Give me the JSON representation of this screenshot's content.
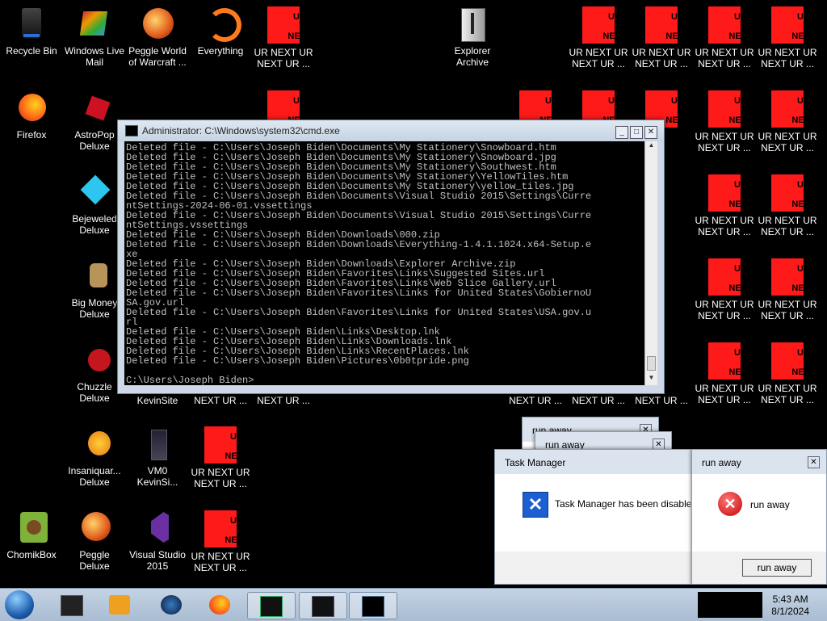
{
  "desktop": {
    "icons": [
      {
        "label": "Recycle Bin"
      },
      {
        "label": "Windows Live\nMail"
      },
      {
        "label": "Peggle World\nof Warcraft ..."
      },
      {
        "label": "Everything"
      },
      {
        "label": "UR NEXT UR\nNEXT UR ..."
      },
      {
        "label": "Explorer\nArchive"
      },
      {
        "label": "Firefox"
      },
      {
        "label": "AstroPop\nDeluxe"
      },
      {
        "label": "Bejeweled\nDeluxe"
      },
      {
        "label": "Big Money\nDeluxe"
      },
      {
        "label": "Chuzzle\nDeluxe"
      },
      {
        "label": "KevinSite"
      },
      {
        "label": "Insaniquar...\nDeluxe"
      },
      {
        "label": "VM0\nKevinSi..."
      },
      {
        "label": "ChomikBox"
      },
      {
        "label": "Peggle Deluxe"
      },
      {
        "label": "Visual Studio\n2015"
      }
    ],
    "ur_icon": {
      "top": "UR",
      "bottom": "NEXT",
      "label": "UR NEXT UR\nNEXT UR ...",
      "partial_label": "NEXT UR ..."
    }
  },
  "cmd": {
    "title": "Administrator: C:\\Windows\\system32\\cmd.exe",
    "lines": [
      "Deleted file - C:\\Users\\Joseph Biden\\Documents\\My Stationery\\Snowboard.htm",
      "Deleted file - C:\\Users\\Joseph Biden\\Documents\\My Stationery\\Snowboard.jpg",
      "Deleted file - C:\\Users\\Joseph Biden\\Documents\\My Stationery\\Southwest.htm",
      "Deleted file - C:\\Users\\Joseph Biden\\Documents\\My Stationery\\YellowTiles.htm",
      "Deleted file - C:\\Users\\Joseph Biden\\Documents\\My Stationery\\yellow_tiles.jpg",
      "Deleted file - C:\\Users\\Joseph Biden\\Documents\\Visual Studio 2015\\Settings\\Curre",
      "ntSettings-2024-06-01.vssettings",
      "Deleted file - C:\\Users\\Joseph Biden\\Documents\\Visual Studio 2015\\Settings\\Curre",
      "ntSettings.vssettings",
      "Deleted file - C:\\Users\\Joseph Biden\\Downloads\\000.zip",
      "Deleted file - C:\\Users\\Joseph Biden\\Downloads\\Everything-1.4.1.1024.x64-Setup.e",
      "xe",
      "Deleted file - C:\\Users\\Joseph Biden\\Downloads\\Explorer Archive.zip",
      "Deleted file - C:\\Users\\Joseph Biden\\Favorites\\Links\\Suggested Sites.url",
      "Deleted file - C:\\Users\\Joseph Biden\\Favorites\\Links\\Web Slice Gallery.url",
      "Deleted file - C:\\Users\\Joseph Biden\\Favorites\\Links for United States\\GobiernoU",
      "SA.gov.url",
      "Deleted file - C:\\Users\\Joseph Biden\\Favorites\\Links for United States\\USA.gov.u",
      "rl",
      "Deleted file - C:\\Users\\Joseph Biden\\Links\\Desktop.lnk",
      "Deleted file - C:\\Users\\Joseph Biden\\Links\\Downloads.lnk",
      "Deleted file - C:\\Users\\Joseph Biden\\Links\\RecentPlaces.lnk",
      "Deleted file - C:\\Users\\Joseph Biden\\Pictures\\0b0tpride.png",
      "",
      "C:\\Users\\Joseph Biden>"
    ]
  },
  "task_manager_dialog": {
    "title": "Task Manager",
    "message": "Task Manager has been disabled"
  },
  "run_away_dialog": {
    "title": "run away",
    "message": "run away",
    "button": "run away"
  },
  "run_away_back": {
    "title": "run away"
  },
  "taskbar": {
    "clock_time": "5:43 AM",
    "clock_date": "8/1/2024"
  },
  "colors": {
    "ur_red": "#ff1a1a",
    "taskbar": "#b5c7da"
  }
}
